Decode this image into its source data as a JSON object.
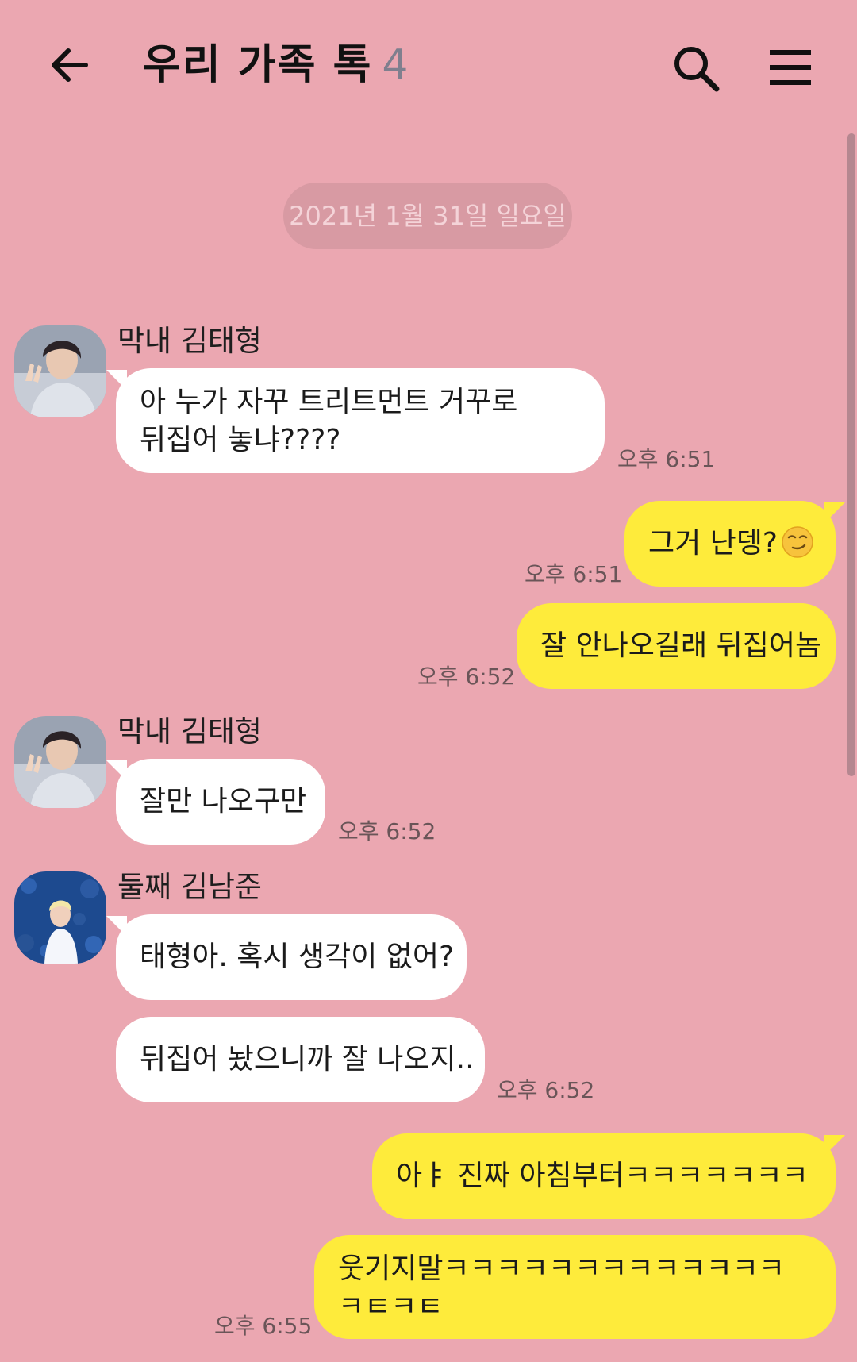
{
  "header": {
    "title": "우리 가족 톡",
    "member_count": "4"
  },
  "date_divider": "2021년 1월 31일 일요일",
  "messages": [
    {
      "sender": "막내 김태형",
      "text_lines": [
        "아 누가 자꾸 트리트먼트 거꾸로",
        "뒤집어 놓냐????"
      ],
      "time": "오후 6:51"
    },
    {
      "text": "그거 난뎅?",
      "emoji": "smirk-face",
      "time": "오후 6:51"
    },
    {
      "text": "잘 안나오길래 뒤집어놈",
      "time": "오후 6:52"
    },
    {
      "sender": "막내 김태형",
      "text": "잘만 나오구만",
      "time": "오후 6:52"
    },
    {
      "sender": "둘째 김남준",
      "text": "태형아. 혹시 생각이 없어?"
    },
    {
      "text": "뒤집어 놨으니까 잘 나오지..",
      "time": "오후 6:52"
    },
    {
      "text": "아ㅑ 진짜 아침부터ㅋㅋㅋㅋㅋㅋㅋ"
    },
    {
      "text_lines": [
        "웃기지말ㅋㅋㅋㅋㅋㅋㅋㅋㅋㅋㅋㅋㅋ",
        "ㅋㅌㅋㅌ"
      ],
      "time": "오후 6:55"
    }
  ],
  "colors": {
    "background": "#eba7b1",
    "incoming_bubble": "#ffffff",
    "outgoing_bubble": "#feeb3b",
    "date_pill": "#d89aa3"
  }
}
